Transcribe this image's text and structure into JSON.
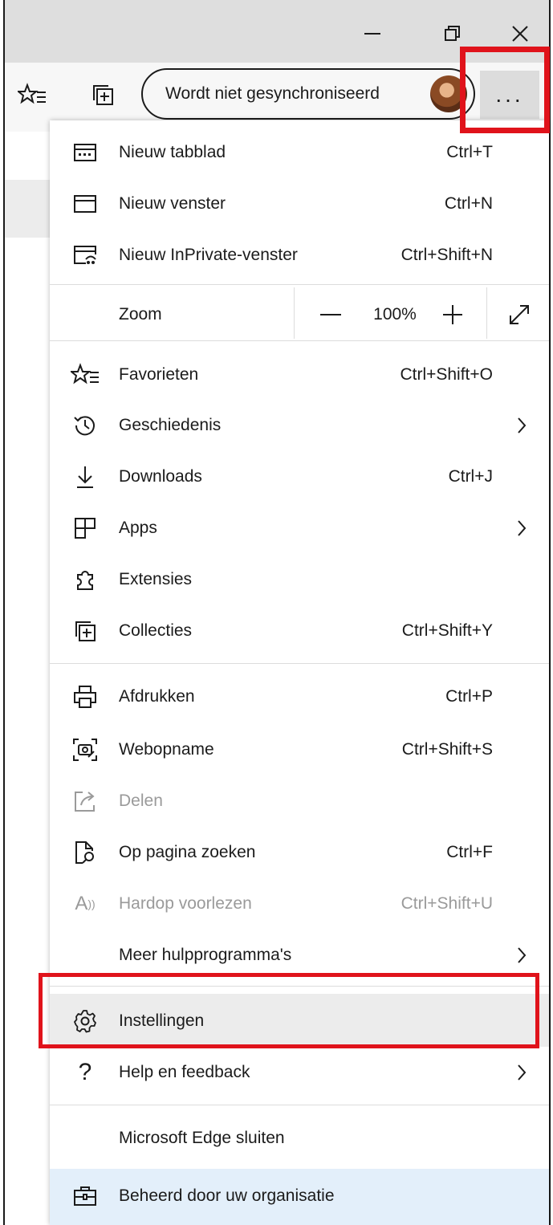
{
  "window": {
    "minimize_icon": "minimize-icon",
    "restore_icon": "restore-icon",
    "close_icon": "close-icon"
  },
  "toolbar": {
    "favorites_icon": "favorites-star-icon",
    "collections_icon": "collections-icon",
    "profile_label": "Wordt niet gesynchroniseerd",
    "more_label": "...",
    "accent_color": "#e0131b"
  },
  "menu": {
    "items": [
      {
        "label": "Nieuw tabblad",
        "shortcut": "Ctrl+T",
        "icon": "new-tab-icon"
      },
      {
        "label": "Nieuw venster",
        "shortcut": "Ctrl+N",
        "icon": "new-window-icon"
      },
      {
        "label": "Nieuw InPrivate-venster",
        "shortcut": "Ctrl+Shift+N",
        "icon": "inprivate-icon"
      }
    ],
    "zoom": {
      "label": "Zoom",
      "value": "100%",
      "minus": "—",
      "plus": "+"
    },
    "items2": [
      {
        "label": "Favorieten",
        "shortcut": "Ctrl+Shift+O",
        "icon": "favorites-icon"
      },
      {
        "label": "Geschiedenis",
        "shortcut": "",
        "icon": "history-icon"
      },
      {
        "label": "Downloads",
        "shortcut": "Ctrl+J",
        "icon": "download-icon"
      },
      {
        "label": "Apps",
        "shortcut": "",
        "icon": "apps-icon"
      },
      {
        "label": "Extensies",
        "shortcut": "",
        "icon": "extensions-icon"
      },
      {
        "label": "Collecties",
        "shortcut": "Ctrl+Shift+Y",
        "icon": "collections-icon"
      }
    ],
    "items3": [
      {
        "label": "Afdrukken",
        "shortcut": "Ctrl+P",
        "icon": "print-icon"
      },
      {
        "label": "Webopname",
        "shortcut": "Ctrl+Shift+S",
        "icon": "web-capture-icon"
      },
      {
        "label": "Delen",
        "shortcut": "",
        "icon": "share-icon"
      },
      {
        "label": "Op pagina zoeken",
        "shortcut": "Ctrl+F",
        "icon": "find-on-page-icon"
      },
      {
        "label": "Hardop voorlezen",
        "shortcut": "Ctrl+Shift+U",
        "icon": "read-aloud-icon"
      },
      {
        "label": "Meer hulpprogramma's",
        "shortcut": "",
        "icon": ""
      }
    ],
    "items4": [
      {
        "label": "Instellingen",
        "shortcut": "",
        "icon": "settings-gear-icon"
      },
      {
        "label": "Help en feedback",
        "shortcut": "",
        "icon": "help-icon"
      }
    ],
    "close_label": "Microsoft Edge sluiten",
    "managed_label": "Beheerd door uw organisatie",
    "read_aloud_glyph": "A",
    "help_glyph": "?"
  }
}
